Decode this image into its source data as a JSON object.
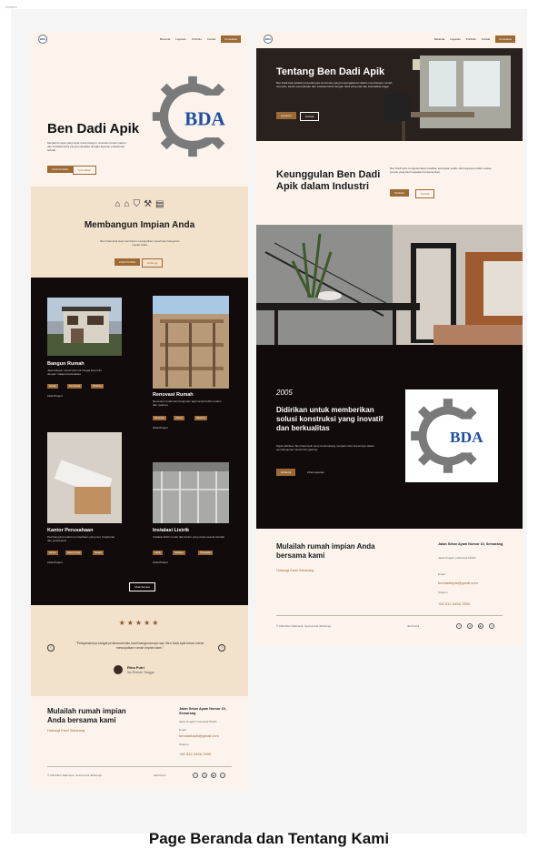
{
  "canvas_label": "Screen",
  "caption": "Page Beranda dan Tentang Kami",
  "colors": {
    "accent": "#9c6a35",
    "dark": "#120b0c",
    "cream": "#fbf3ec",
    "tan": "#f2e2cc",
    "logo_blue": "#1e4fa3"
  },
  "logo": {
    "text": "BDA",
    "icon": "gear-logo"
  },
  "nav": {
    "links": [
      "Beranda",
      "Layanan",
      "Portfolio",
      "Kontak"
    ],
    "cta": "Konsultasi"
  },
  "navB": {
    "links": [
      "Beranda",
      "Layanan",
      "Portfolio",
      "Kontak"
    ],
    "cta": "Konsultasi"
  },
  "home": {
    "hero_title": "Ben Dadi Apik",
    "hero_text": "Menjadi tempat yang tepat untuk bangun, renovasi rumah, kantor dan instalasi listrik yang berkualitas dengan layanan profesional terbaik.",
    "hero_btn1": "Lihat Portfolio",
    "hero_btn2": "Konsultasi",
    "build_title": "Membangun Impian Anda",
    "build_text": "Ben Dadi Apik siap membantu mewujudkan rumah dan bangunan impian Anda.",
    "build_btn1": "Lihat Portfolio",
    "build_btn2": "Hubungi",
    "icons": [
      "house-icon",
      "home-icon",
      "shield-icon",
      "tools-icon",
      "building-icon"
    ],
    "cards": [
      {
        "title": "Bangun Rumah",
        "desc": "Jasa bangun rumah dari nol hingga siap huni dengan material berkualitas.",
        "tags": [
          "Desain",
          "Konstruksi",
          "Finishing"
        ],
        "more": "Lihat Project"
      },
      {
        "title": "Renovasi Rumah",
        "desc": "Renovasi rumah dan bangunan agar tampil lebih modern dan nyaman.",
        "tags": [
          "Renovasi",
          "Interior",
          "Eksterior"
        ],
        "more": "Lihat Project"
      },
      {
        "title": "Kantor Perusahaan",
        "desc": "Pembangunan kantor perusahaan yang rapi, fungsional dan profesional.",
        "tags": [
          "Kantor",
          "Ruang Kerja",
          "Desain"
        ],
        "more": "Lihat Project"
      },
      {
        "title": "Instalasi Listrik",
        "desc": "Instalasi listrik rumah dan kantor yang aman sesuai standar.",
        "tags": [
          "Listrik",
          "Instalasi",
          "Perawatan"
        ],
        "more": "Lihat Project"
      }
    ],
    "see_all": "Lihat Semua",
    "stars": "★★★★★",
    "testimonial": "\"Pelayanannya sangat profesional dan hasil bangunannya rapi. Ben Dadi Apik benar-benar mewujudkan rumah impian kami.\"",
    "person_name": "Rina Putri",
    "person_role": "Ibu Rumah Tangga",
    "footer_title": "Mulailah rumah impian Anda bersama kami",
    "footer_link": "Hubungi Kami Sekarang",
    "footer_address_title": "Jalan Sekar Ayam Nomor 10, Semarang",
    "footer_address_sub": "Jawa Tengah, Indonesia 50123",
    "footer_email_label": "Email",
    "footer_email": "bendadiapik@gmail.com",
    "footer_phone_label": "Telepon",
    "footer_phone": "+62 812-3456-7890",
    "copyright": "© 2024 Ben Dadi Apik. Semua hak dilindungi.",
    "follow": "Ikuti Kami",
    "socials": [
      "facebook-icon",
      "instagram-icon",
      "youtube-icon",
      "twitter-icon"
    ]
  },
  "about": {
    "hero_title": "Tentang Ben Dadi Apik",
    "hero_text": "Ben Dadi Apik adalah penyedia jasa konstruksi yang berpengalaman dalam membangun rumah, renovasi, kantor perusahaan dan instalasi listrik dengan hasil yang rapi dan berkualitas tinggi.",
    "hero_btn1": "Layanan",
    "hero_btn2": "Kontak",
    "keung_title": "Keunggulan Ben Dadi Apik dalam Industri",
    "keung_text": "Ben Dadi Apik mengutamakan kualitas, ketepatan waktu dan kejujuran dalam setiap proyek yang kami kerjakan bersama klien.",
    "keung_btn1": "Portfolio",
    "keung_btn2": "Kontak",
    "year": "2005",
    "est_title": "Didirikan untuk memberikan solusi konstruksi yang inovatif dan berkualitas",
    "est_text": "Sejak didirikan, Ben Dadi Apik terus berkembang menjadi mitra terpercaya dalam pembangunan rumah dan gedung.",
    "est_btn1": "Hubungi",
    "est_btn2": "Lihat Layanan",
    "footer_title": "Mulailah rumah impian Anda bersama kami",
    "footer_link": "Hubungi Kami Sekarang",
    "footer_address_title": "Jalan Sekar Ayam Nomor 10, Semarang",
    "footer_address_sub": "Jawa Tengah, Indonesia 50123",
    "footer_email_label": "Email",
    "footer_email": "bendadiapik@gmail.com",
    "footer_phone_label": "Telepon",
    "footer_phone": "+62 812-3456-7890",
    "copyright": "© 2024 Ben Dadi Apik. Semua hak dilindungi.",
    "follow": "Ikuti Kami"
  }
}
